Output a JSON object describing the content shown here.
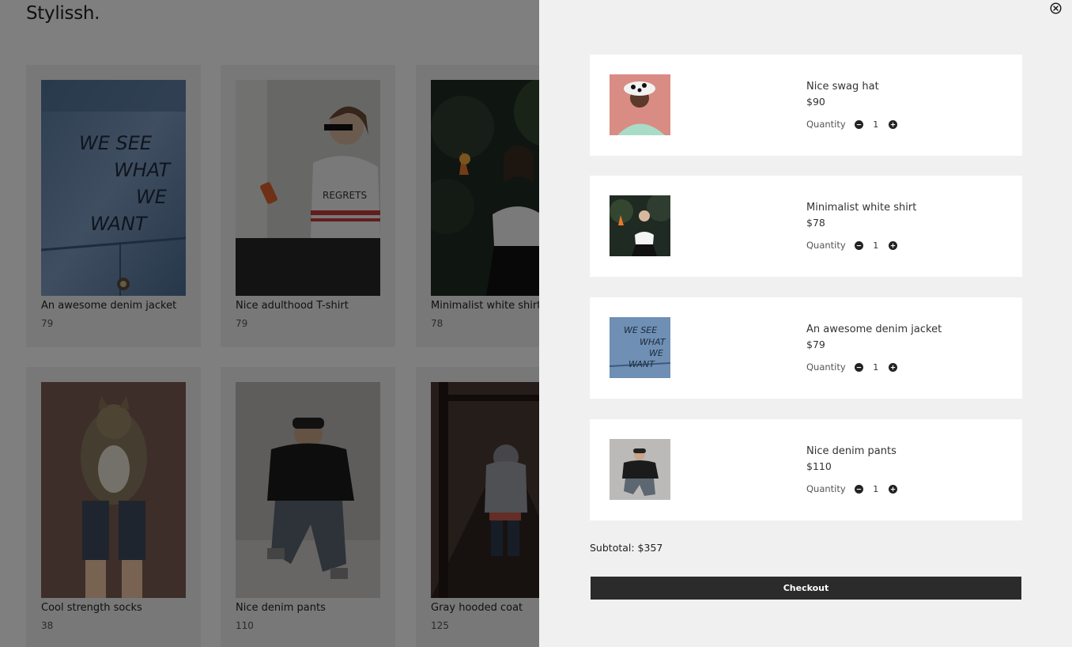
{
  "store": {
    "brand": "Stylissh.",
    "products": [
      {
        "title": "An awesome denim jacket",
        "price": "79"
      },
      {
        "title": "Nice adulthood T-shirt",
        "price": "79"
      },
      {
        "title": "Minimalist white shirt",
        "price": "78"
      },
      {
        "title": "Cool strength socks",
        "price": "38"
      },
      {
        "title": "Nice denim pants",
        "price": "110"
      },
      {
        "title": "Gray hooded coat",
        "price": "125"
      }
    ],
    "jacket_print": [
      "WE SEE",
      "WHAT",
      "WE",
      "WANT"
    ],
    "tshirt_print": "REGRETS"
  },
  "cart": {
    "items": [
      {
        "name": "Nice swag hat",
        "price": "$90",
        "qty_label": "Quantity",
        "qty": "1"
      },
      {
        "name": "Minimalist white shirt",
        "price": "$78",
        "qty_label": "Quantity",
        "qty": "1"
      },
      {
        "name": "An awesome denim jacket",
        "price": "$79",
        "qty_label": "Quantity",
        "qty": "1"
      },
      {
        "name": "Nice denim pants",
        "price": "$110",
        "qty_label": "Quantity",
        "qty": "1"
      }
    ],
    "subtotal": "Subtotal: $357",
    "checkout_label": "Checkout"
  },
  "icons": {
    "close": "close-circle-icon",
    "decrease": "minus-circle-icon",
    "increase": "plus-circle-icon"
  },
  "colors": {
    "drawer_bg": "#f0f0f0",
    "card_bg": "#f1f1f1",
    "checkout_bg": "#2b2b2b",
    "overlay": "rgba(0,0,0,0.5)"
  }
}
